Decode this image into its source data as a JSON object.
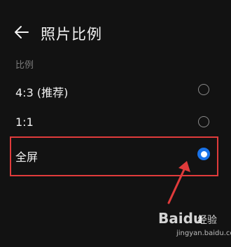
{
  "header": {
    "title": "照片比例"
  },
  "section": {
    "label": "比例"
  },
  "options": [
    {
      "label": "4:3 (推荐)",
      "selected": false
    },
    {
      "label": "1:1",
      "selected": false
    },
    {
      "label": "全屏",
      "selected": true
    }
  ],
  "colors": {
    "background": "#121212",
    "accent": "#1a73e8",
    "annotation": "#e03b3b"
  },
  "watermark": {
    "brand": "Baidu",
    "jingyan": "经验",
    "url": "jingyan.baidu.com"
  }
}
